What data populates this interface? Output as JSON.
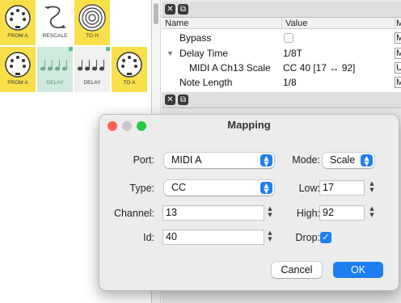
{
  "modules": [
    {
      "label": "FROM A",
      "icon": "midi-din-icon",
      "color": "yellow"
    },
    {
      "label": "RESCALE",
      "icon": "rescale-curve-icon",
      "color": "white"
    },
    {
      "label": "TO H",
      "icon": "concentric-rings-icon",
      "color": "yellow"
    },
    {
      "label": "FROM A",
      "icon": "midi-din-icon",
      "color": "yellow"
    },
    {
      "label": "DELAY",
      "icon": "notes-icon",
      "color": "green"
    },
    {
      "label": "DELAY",
      "icon": "notes-icon",
      "color": "grey"
    },
    {
      "label": "TO A",
      "icon": "midi-din-icon",
      "color": "yellow"
    }
  ],
  "properties": {
    "headers": {
      "name": "Name",
      "value": "Value",
      "more": "M"
    },
    "rows": [
      {
        "name": "Bypass",
        "value": "",
        "more": "M"
      },
      {
        "name": "Delay Time",
        "value": "1/8T",
        "more": "M"
      },
      {
        "name": "MIDI A Ch13 Scale",
        "value": "CC 40 [17 ↔ 92]",
        "more": "U"
      },
      {
        "name": "Note Length",
        "value": "1/8",
        "more": "M"
      }
    ]
  },
  "dialog": {
    "title": "Mapping",
    "port_label": "Port:",
    "port_value": "MIDI A",
    "mode_label": "Mode:",
    "mode_value": "Scale",
    "type_label": "Type:",
    "type_value": "CC",
    "low_label": "Low:",
    "low_value": "17",
    "channel_label": "Channel:",
    "channel_value": "13",
    "high_label": "High:",
    "high_value": "92",
    "id_label": "Id:",
    "id_value": "40",
    "drop_label": "Drop:",
    "drop_checked": true,
    "cancel_label": "Cancel",
    "ok_label": "OK"
  },
  "colors": {
    "accent": "#1e7ef0",
    "module_yellow": "#f9e04b",
    "module_green": "#cfe9dc"
  }
}
